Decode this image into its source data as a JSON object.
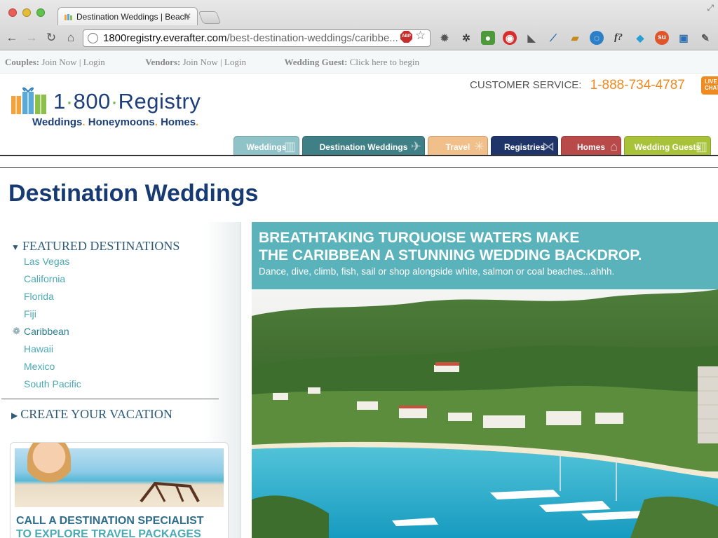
{
  "browser": {
    "tab_title": "Destination Weddings | Beach",
    "tab_close": "✕",
    "url_host": "1800registry.everafter.com",
    "url_path": "/best-destination-weddings/caribbe...",
    "abp_label": "ABP",
    "extension_f_label": "f?",
    "extension_su_label": "su"
  },
  "topbar": {
    "couples_label": "Couples:",
    "couples_join": "Join Now",
    "couples_sep": "|",
    "couples_login": "Login",
    "vendors_label": "Vendors:",
    "vendors_join": "Join Now",
    "vendors_sep": "|",
    "vendors_login": "Login",
    "guest_label": "Wedding Guest:",
    "guest_link": "Click here to begin"
  },
  "logo": {
    "part1": "1",
    "dot": "·",
    "part2": "800",
    "part3": "Registry",
    "tag1": "Weddings",
    "tag2": "Honeymoons",
    "tag3": "Homes",
    "tagdot": "."
  },
  "customer_service": {
    "label": "CUSTOMER SERVICE:",
    "phone": "1-888-734-4787",
    "livechat": "LIVE CHAT"
  },
  "nav_tabs": [
    {
      "label": "Weddings",
      "color": "#8fc3c8"
    },
    {
      "label": "Destination Weddings",
      "color": "#3f7f86"
    },
    {
      "label": "Travel",
      "color": "#f1c08a"
    },
    {
      "label": "Registries",
      "color": "#1f3569"
    },
    {
      "label": "Homes",
      "color": "#b84a4a"
    },
    {
      "label": "Wedding Guests",
      "color": "#a8c23a"
    }
  ],
  "page_title": "Destination Weddings",
  "sidebar": {
    "featured_heading": "FEATURED DESTINATIONS",
    "destinations": [
      "Las Vegas",
      "California",
      "Florida",
      "Fiji",
      "Caribbean",
      "Hawaii",
      "Mexico",
      "South Pacific"
    ],
    "active_destination": "Caribbean",
    "create_heading": "CREATE YOUR VACATION",
    "promo_line1": "CALL A DESTINATION SPECIALIST",
    "promo_line2": "TO EXPLORE TRAVEL PACKAGES"
  },
  "hero": {
    "headline_line1": "BREATHTAKING TURQUOISE WATERS MAKE",
    "headline_line2": "THE CARIBBEAN A STUNNING WEDDING BACKDROP.",
    "subtext": "Dance, dive, climb, fish, sail or shop alongside white, salmon or coal beaches...ahhh."
  },
  "colors": {
    "brand_navy": "#173a72",
    "accent_teal": "#5ab2bb",
    "link_teal": "#4baab5",
    "phone_orange": "#f08a1e"
  }
}
